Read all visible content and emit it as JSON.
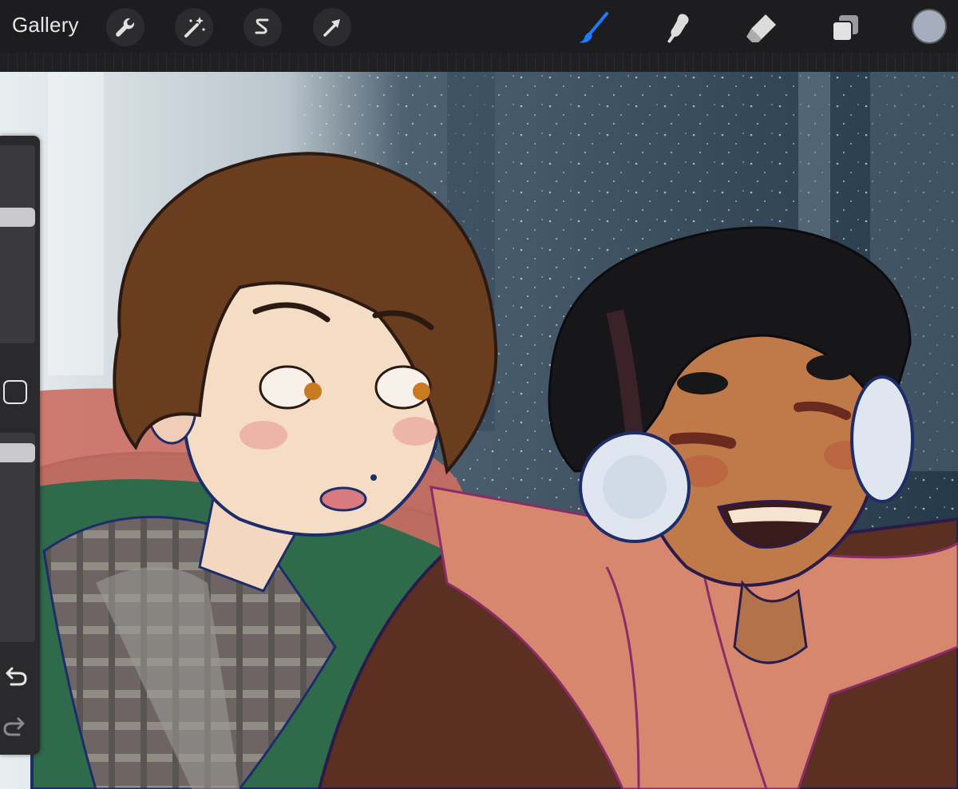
{
  "toolbar": {
    "gallery_label": "Gallery",
    "left_tools": [
      {
        "name": "actions",
        "icon": "wrench-icon"
      },
      {
        "name": "adjustments",
        "icon": "magic-wand-icon"
      },
      {
        "name": "selection",
        "icon": "selection-s-icon"
      },
      {
        "name": "transform",
        "icon": "arrow-cursor-icon"
      }
    ],
    "right_tools": [
      {
        "name": "brush",
        "icon": "brush-icon",
        "active": true
      },
      {
        "name": "smudge",
        "icon": "smudge-icon"
      },
      {
        "name": "eraser",
        "icon": "eraser-icon"
      },
      {
        "name": "layers",
        "icon": "layers-icon"
      }
    ],
    "accent_color": "#1e7bff",
    "current_color": "#a6adbc"
  },
  "sidebar": {
    "size_slider_level": 0.4,
    "opacity_slider_level": 0.05,
    "modify_icon": "square-icon",
    "undo_icon": "undo-icon",
    "redo_icon": "redo-icon"
  },
  "canvas": {
    "artwork": "digital-illustration",
    "background_color": "#2e3e4c"
  }
}
